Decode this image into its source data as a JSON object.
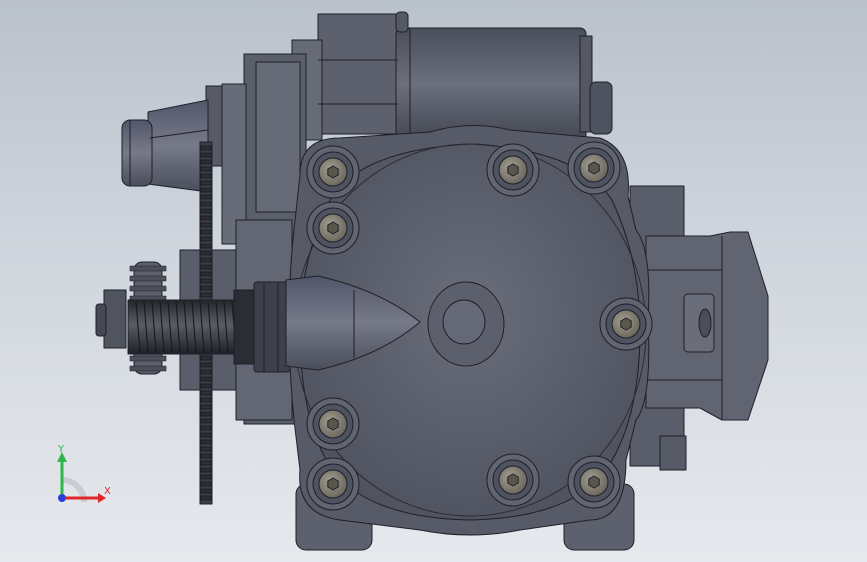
{
  "viewport": {
    "background_top": "#b9c1cc",
    "background_bottom": "#e6e9ed",
    "part_color": "#5f6370",
    "part_dark": "#3d414c",
    "edge_color": "#1e2028",
    "bolt_color": "#8c877a"
  },
  "triad": {
    "x_label": "X",
    "y_label": "Y",
    "x_color": "#e0282a",
    "y_color": "#2fb54a",
    "z_color": "#2a3fd8"
  },
  "bolt_count": 9
}
